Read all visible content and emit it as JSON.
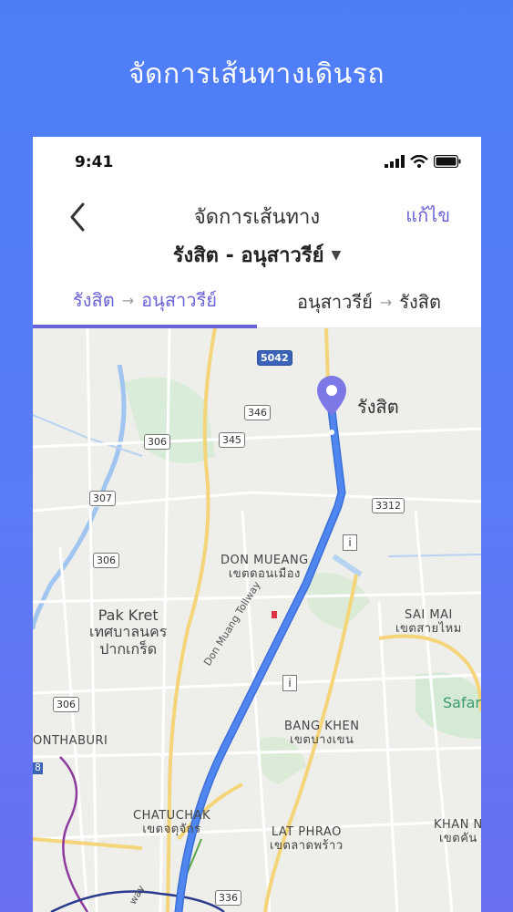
{
  "banner_title": "จัดการเส้นทางเดินรถ",
  "status": {
    "time": "9:41"
  },
  "header": {
    "title": "จัดการเส้นทาง",
    "edit_label": "แก้ไข",
    "route_label": "รังสิต - อนุสาวรีย์"
  },
  "tabs": [
    {
      "from": "รังสิต",
      "arrow": "→",
      "to": "อนุสาวรีย์",
      "active": true
    },
    {
      "from": "อนุสาวรีย์",
      "arrow": "→",
      "to": "รังสิต",
      "active": false
    }
  ],
  "map": {
    "destination": "รังสิต",
    "highway_badge": "5042",
    "road_badges": [
      "346",
      "306",
      "345",
      "307",
      "306",
      "3312",
      "306",
      "336"
    ],
    "labels": {
      "don_mueang_en": "DON MUEANG",
      "don_mueang_th": "เขตดอนเมือง",
      "pak_kret_en": "Pak Kret",
      "pak_kret_th1": "เทศบาลนคร",
      "pak_kret_th2": "ปากเกร็ด",
      "sai_mai_en": "SAI MAI",
      "sai_mai_th": "เขตสายไหม",
      "bang_khen_en": "BANG KHEN",
      "bang_khen_th": "เขตบางเขน",
      "chatuchak_en": "CHATUCHAK",
      "chatuchak_th": "เขตจตุจักร",
      "lat_phrao_en": "LAT PHRAO",
      "lat_phrao_th": "เขตลาดพร้าว",
      "khan_en": "KHAN N",
      "khan_th": "เขตคัน",
      "nonthaburi": "ONTHABURI",
      "safari": "Safar",
      "tollway": "Don Muang Tollway",
      "way": "way",
      "info_symbol": "i",
      "badge_8": "8"
    },
    "colors": {
      "route": "#4f86f0",
      "pin": "#7c78e6",
      "accent": "#6b63d8"
    }
  }
}
